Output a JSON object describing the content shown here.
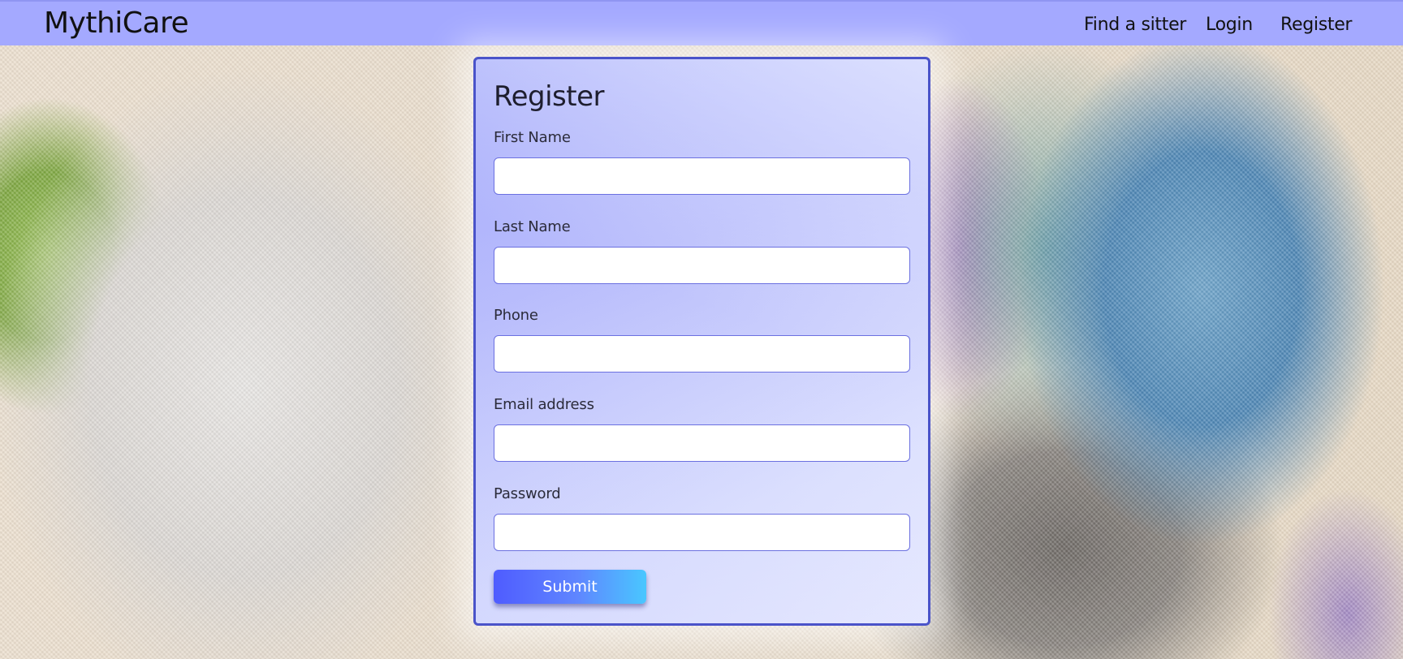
{
  "navbar": {
    "brand": "MythiCare",
    "links": {
      "find_sitter": "Find a sitter",
      "login": "Login",
      "register": "Register"
    },
    "background_color": "#a4a9ff"
  },
  "register_form": {
    "title": "Register",
    "fields": {
      "first_name": {
        "label": "First Name",
        "value": ""
      },
      "last_name": {
        "label": "Last Name",
        "value": ""
      },
      "phone": {
        "label": "Phone",
        "value": ""
      },
      "email": {
        "label": "Email address",
        "value": ""
      },
      "password": {
        "label": "Password",
        "value": ""
      }
    },
    "submit_label": "Submit",
    "border_color": "#4a53c9"
  }
}
